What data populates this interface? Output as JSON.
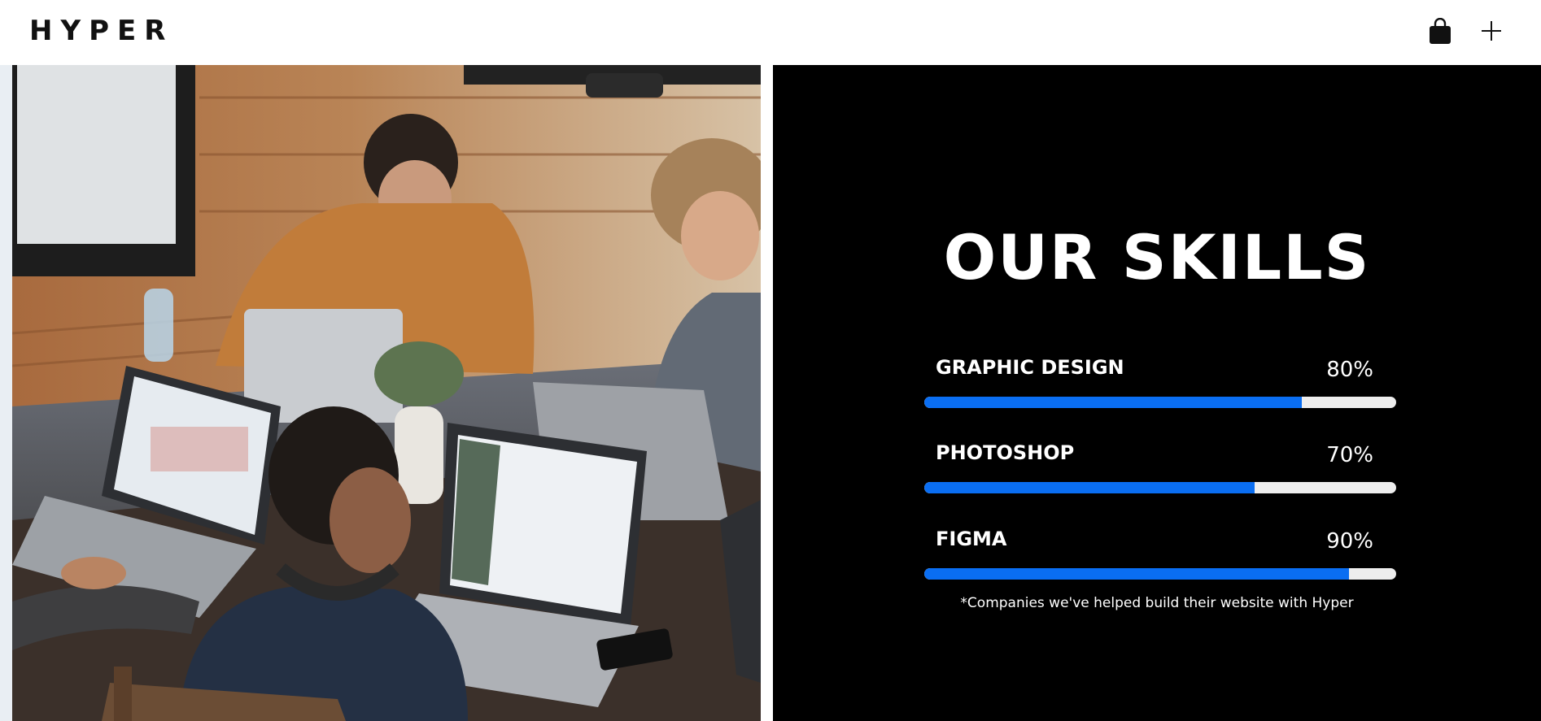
{
  "header": {
    "logo": "HYPER",
    "cart_icon": "shopping-bag-icon",
    "menu_icon": "plus-icon"
  },
  "photo": {
    "icon": "team-working-on-laptops-photo"
  },
  "skills": {
    "title": "OUR SKILLS",
    "items": [
      {
        "name": "GRAPHIC DESIGN",
        "percent_label": "80%",
        "value": 0.8
      },
      {
        "name": "PHOTOSHOP",
        "percent_label": "70%",
        "value": 0.7
      },
      {
        "name": "FIGMA",
        "percent_label": "90%",
        "value": 0.9
      }
    ],
    "footnote": "*Companies we've helped build their website with Hyper"
  },
  "colors": {
    "accent": "#0a6ef2",
    "track": "#eeeeee",
    "panel_bg": "#000000"
  }
}
